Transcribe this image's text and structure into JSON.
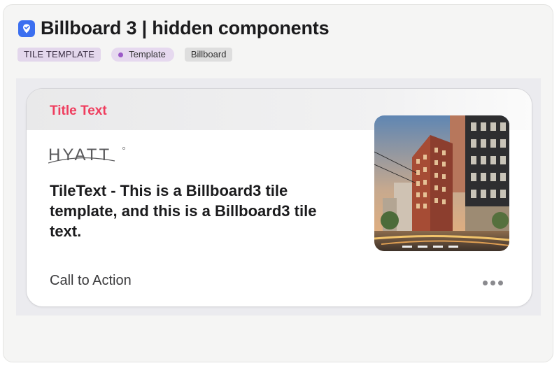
{
  "header": {
    "icon": "location-pin-icon",
    "title": "Billboard 3 | hidden components"
  },
  "tags": {
    "type_label": "TILE TEMPLATE",
    "template_label": "Template",
    "category_label": "Billboard"
  },
  "tile": {
    "title": "Title Text",
    "logo_text": "HYATT",
    "text": "TileText - This is a Billboard3 tile template, and this is a Billboard3 tile text.",
    "cta_label": "Call to Action",
    "image": "city-building-photo",
    "more_icon": "ellipsis-icon"
  },
  "colors": {
    "accent": "#ef3d5e",
    "app_icon": "#3b6ff0",
    "tag_purple": "#e3d7ec",
    "dot": "#9b59c7"
  }
}
